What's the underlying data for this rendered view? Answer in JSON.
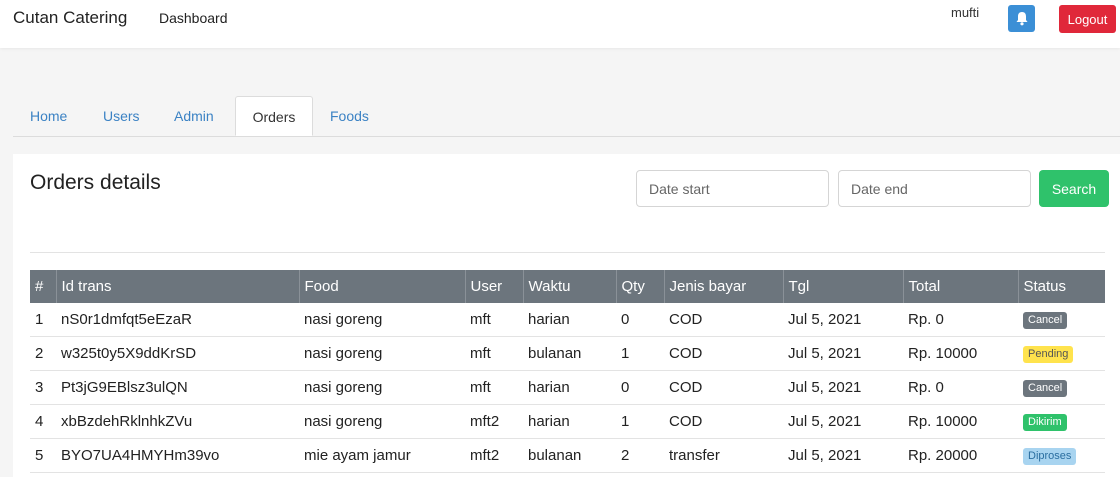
{
  "navbar": {
    "brand": "Cutan Catering",
    "dashboard_link": "Dashboard",
    "username": "mufti",
    "notification_icon": "bell-icon",
    "logout_label": "Logout"
  },
  "tabs": [
    {
      "label": "Home",
      "active": false
    },
    {
      "label": "Users",
      "active": false
    },
    {
      "label": "Admin",
      "active": false
    },
    {
      "label": "Orders",
      "active": true
    },
    {
      "label": "Foods",
      "active": false
    }
  ],
  "orders": {
    "title": "Orders details",
    "date_start_placeholder": "Date start",
    "date_end_placeholder": "Date end",
    "search_label": "Search",
    "columns": [
      "#",
      "Id trans",
      "Food",
      "User",
      "Waktu",
      "Qty",
      "Jenis bayar",
      "Tgl",
      "Total",
      "Status"
    ],
    "rows": [
      {
        "no": "1",
        "id_trans": "nS0r1dmfqt5eEzaR",
        "food": "nasi goreng",
        "user": "mft",
        "waktu": "harian",
        "qty": "0",
        "jenis_bayar": "COD",
        "tgl": "Jul 5, 2021",
        "total": "Rp. 0",
        "status": "Cancel"
      },
      {
        "no": "2",
        "id_trans": "w325t0y5X9ddKrSD",
        "food": "nasi goreng",
        "user": "mft",
        "waktu": "bulanan",
        "qty": "1",
        "jenis_bayar": "COD",
        "tgl": "Jul 5, 2021",
        "total": "Rp. 10000",
        "status": "Pending"
      },
      {
        "no": "3",
        "id_trans": "Pt3jG9EBlsz3ulQN",
        "food": "nasi goreng",
        "user": "mft",
        "waktu": "harian",
        "qty": "0",
        "jenis_bayar": "COD",
        "tgl": "Jul 5, 2021",
        "total": "Rp. 0",
        "status": "Cancel"
      },
      {
        "no": "4",
        "id_trans": "xbBzdehRklnhkZVu",
        "food": "nasi goreng",
        "user": "mft2",
        "waktu": "harian",
        "qty": "1",
        "jenis_bayar": "COD",
        "tgl": "Jul 5, 2021",
        "total": "Rp. 10000",
        "status": "Dikirim"
      },
      {
        "no": "5",
        "id_trans": "BYO7UA4HMYHm39vo",
        "food": "mie ayam jamur",
        "user": "mft2",
        "waktu": "bulanan",
        "qty": "2",
        "jenis_bayar": "transfer",
        "tgl": "Jul 5, 2021",
        "total": "Rp. 20000",
        "status": "Diproses"
      }
    ]
  },
  "colors": {
    "nav_bg": "#ffffff",
    "page_bg": "#f5f5f5",
    "tab_link": "#3b82c4",
    "bell_btn": "#3b8fd6",
    "logout_btn": "#e0283a",
    "search_btn": "#2fc26b",
    "table_header": "#6c757d"
  }
}
